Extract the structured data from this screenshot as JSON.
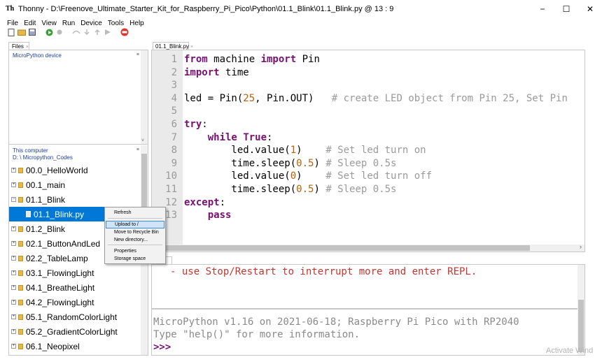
{
  "window": {
    "title": "Thonny  -  D:\\Freenove_Ultimate_Starter_Kit_for_Raspberry_Pi_Pico\\Python\\01.1_Blink\\01.1_Blink.py  @  13 : 9",
    "app_icon": "Th",
    "minimize": "−",
    "maximize": "☐",
    "close": "✕"
  },
  "menu": [
    "File",
    "Edit",
    "View",
    "Run",
    "Device",
    "Tools",
    "Help"
  ],
  "toolbar_icons": [
    "new-file-icon",
    "open-folder-icon",
    "save-icon",
    "run-icon",
    "debug-icon",
    "step-over-icon",
    "step-into-icon",
    "step-out-icon",
    "resume-icon",
    "stop-icon"
  ],
  "files_panel": {
    "tab_label": "Files",
    "tab_close": "×",
    "micropython_title": "MicroPython device",
    "menu_icon": "≡",
    "computer_title": "This computer",
    "computer_path": "D: \\ Micropython_Codes",
    "items": [
      {
        "label": "00.0_HelloWorld",
        "type": "folder",
        "expanded": false
      },
      {
        "label": "00.1_main",
        "type": "folder",
        "expanded": false
      },
      {
        "label": "01.1_Blink",
        "type": "folder",
        "expanded": true
      },
      {
        "label": "01.1_Blink.py",
        "type": "file",
        "selected": true
      },
      {
        "label": "01.2_Blink",
        "type": "folder",
        "expanded": false
      },
      {
        "label": "02.1_ButtonAndLed",
        "type": "folder",
        "expanded": false
      },
      {
        "label": "02.2_TableLamp",
        "type": "folder",
        "expanded": false
      },
      {
        "label": "03.1_FlowingLight",
        "type": "folder",
        "expanded": false
      },
      {
        "label": "04.1_BreatheLight",
        "type": "folder",
        "expanded": false
      },
      {
        "label": "04.2_FlowingLight",
        "type": "folder",
        "expanded": false
      },
      {
        "label": "05.1_RandomColorLight",
        "type": "folder",
        "expanded": false
      },
      {
        "label": "05.2_GradientColorLight",
        "type": "folder",
        "expanded": false
      },
      {
        "label": "06.1_Neopixel",
        "type": "folder",
        "expanded": false
      }
    ]
  },
  "context_menu": {
    "items": [
      "Refresh",
      "Upload to /",
      "Move to Recycle Bin",
      "New directory...",
      "Properties",
      "Storage space"
    ],
    "highlighted": "Upload to /"
  },
  "editor": {
    "tab_label": "01.1_Blink.py",
    "tab_close": "×",
    "lines": [
      {
        "n": "1",
        "segs": [
          [
            "kw",
            "from"
          ],
          [
            "t",
            " machine "
          ],
          [
            "kw",
            "import"
          ],
          [
            "t",
            " Pin"
          ]
        ]
      },
      {
        "n": "2",
        "segs": [
          [
            "kw",
            "import"
          ],
          [
            "t",
            " time"
          ]
        ]
      },
      {
        "n": "3",
        "segs": []
      },
      {
        "n": "4",
        "segs": [
          [
            "t",
            "led = Pin("
          ],
          [
            "num",
            "25"
          ],
          [
            "t",
            ", Pin.OUT)   "
          ],
          [
            "cm",
            "# create LED object from Pin 25, Set Pin"
          ]
        ]
      },
      {
        "n": "5",
        "segs": []
      },
      {
        "n": "6",
        "segs": [
          [
            "kw",
            "try"
          ],
          [
            "t",
            ":"
          ]
        ]
      },
      {
        "n": "7",
        "segs": [
          [
            "t",
            "    "
          ],
          [
            "kw",
            "while"
          ],
          [
            "t",
            " "
          ],
          [
            "kw",
            "True"
          ],
          [
            "t",
            ":"
          ]
        ]
      },
      {
        "n": "8",
        "segs": [
          [
            "t",
            "        led.value("
          ],
          [
            "num",
            "1"
          ],
          [
            "t",
            ")    "
          ],
          [
            "cm",
            "# Set led turn on"
          ]
        ]
      },
      {
        "n": "9",
        "segs": [
          [
            "t",
            "        time.sleep("
          ],
          [
            "num",
            "0.5"
          ],
          [
            "t",
            ") "
          ],
          [
            "cm",
            "# Sleep 0.5s"
          ]
        ]
      },
      {
        "n": "10",
        "segs": [
          [
            "t",
            "        led.value("
          ],
          [
            "num",
            "0"
          ],
          [
            "t",
            ")    "
          ],
          [
            "cm",
            "# Set led turn off"
          ]
        ]
      },
      {
        "n": "11",
        "segs": [
          [
            "t",
            "        time.sleep("
          ],
          [
            "num",
            "0.5"
          ],
          [
            "t",
            ") "
          ],
          [
            "cm",
            "# Sleep 0.5s"
          ]
        ]
      },
      {
        "n": "12",
        "segs": [
          [
            "kw",
            "except"
          ],
          [
            "t",
            ":"
          ]
        ]
      },
      {
        "n": "13",
        "segs": [
          [
            "t",
            "    "
          ],
          [
            "kw",
            "pass"
          ]
        ]
      }
    ],
    "scroll_right": "›"
  },
  "shell": {
    "tab_close": "×",
    "message": "- use Stop/Restart to interrupt more and enter REPL.",
    "info_line1": "MicroPython v1.16 on 2021-06-18; Raspberry Pi Pico with RP2040",
    "info_line2": "Type \"help()\" for more information.",
    "prompt": ">>>"
  },
  "watermark": "Activate Wind",
  "colors": {
    "keyword": "#7a0f74",
    "number": "#b7600a",
    "comment": "#9a9a9a",
    "selection": "#0078d7",
    "error_text": "#c8332d"
  }
}
